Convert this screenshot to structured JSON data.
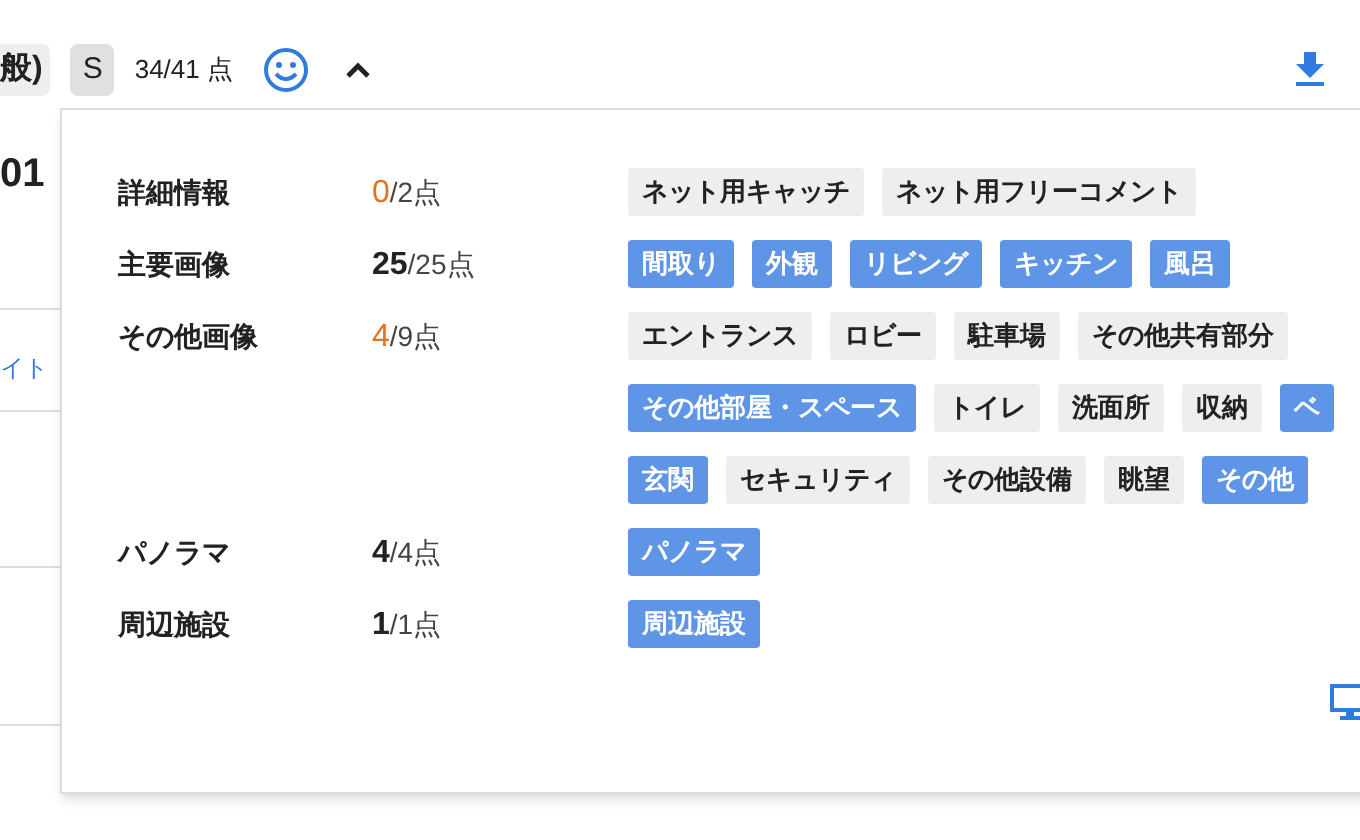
{
  "header": {
    "category_tag": "般)",
    "rank_tag": "S",
    "score": "34/41 点"
  },
  "background": {
    "number": "01",
    "link": "イト"
  },
  "sections": [
    {
      "label": "詳細情報",
      "count": "0",
      "total": "/2点",
      "complete": false,
      "tag_lines": [
        [
          {
            "label": "ネット用キャッチ",
            "done": false
          },
          {
            "label": "ネット用フリーコメント",
            "done": false
          }
        ]
      ]
    },
    {
      "label": "主要画像",
      "count": "25",
      "total": "/25点",
      "complete": true,
      "tag_lines": [
        [
          {
            "label": "間取り",
            "done": true
          },
          {
            "label": "外観",
            "done": true
          },
          {
            "label": "リビング",
            "done": true
          },
          {
            "label": "キッチン",
            "done": true
          },
          {
            "label": "風呂",
            "done": true
          }
        ]
      ]
    },
    {
      "label": "その他画像",
      "count": "4",
      "total": "/9点",
      "complete": false,
      "tag_lines": [
        [
          {
            "label": "エントランス",
            "done": false
          },
          {
            "label": "ロビー",
            "done": false
          },
          {
            "label": "駐車場",
            "done": false
          },
          {
            "label": "その他共有部分",
            "done": false
          }
        ],
        [
          {
            "label": "その他部屋・スペース",
            "done": true
          },
          {
            "label": "トイレ",
            "done": false
          },
          {
            "label": "洗面所",
            "done": false
          },
          {
            "label": "収納",
            "done": false
          },
          {
            "label": "ベ",
            "done": true
          }
        ],
        [
          {
            "label": "玄関",
            "done": true
          },
          {
            "label": "セキュリティ",
            "done": false
          },
          {
            "label": "その他設備",
            "done": false
          },
          {
            "label": "眺望",
            "done": false
          },
          {
            "label": "その他",
            "done": true
          }
        ]
      ]
    },
    {
      "label": "パノラマ",
      "count": "4",
      "total": "/4点",
      "complete": true,
      "tag_lines": [
        [
          {
            "label": "パノラマ",
            "done": true
          }
        ]
      ]
    },
    {
      "label": "周辺施設",
      "count": "1",
      "total": "/1点",
      "complete": true,
      "tag_lines": [
        [
          {
            "label": "周辺施設",
            "done": true
          }
        ]
      ]
    }
  ]
}
